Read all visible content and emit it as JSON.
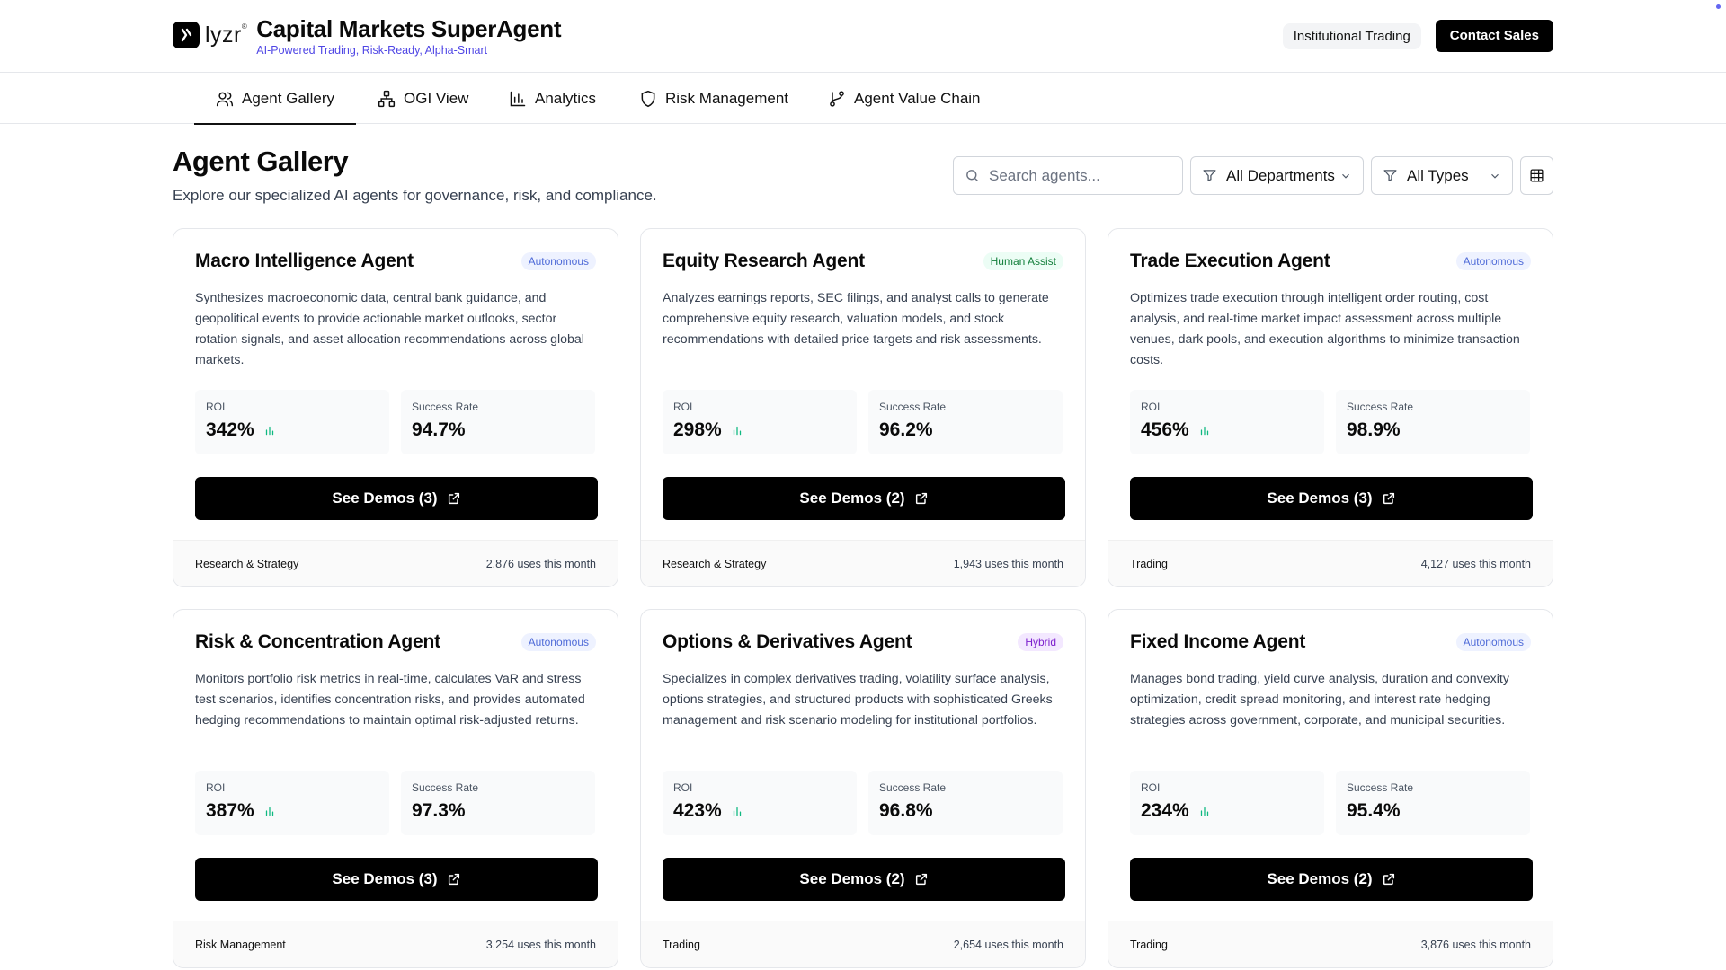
{
  "header": {
    "logo_text": "lyzr",
    "title": "Capital Markets SuperAgent",
    "subtitle": "AI-Powered Trading, Risk-Ready, Alpha-Smart",
    "pill_label": "Institutional Trading",
    "contact_label": "Contact Sales"
  },
  "tabs": [
    {
      "label": "Agent Gallery",
      "icon": "users-icon",
      "active": true
    },
    {
      "label": "OGI View",
      "icon": "network-icon",
      "active": false
    },
    {
      "label": "Analytics",
      "icon": "bar-chart-icon",
      "active": false
    },
    {
      "label": "Risk Management",
      "icon": "shield-icon",
      "active": false
    },
    {
      "label": "Agent Value Chain",
      "icon": "git-branch-icon",
      "active": false
    }
  ],
  "page": {
    "title": "Agent Gallery",
    "description": "Explore our specialized AI agents for governance, risk, and compliance."
  },
  "controls": {
    "search_placeholder": "Search agents...",
    "department_value": "All Departments",
    "type_value": "All Types"
  },
  "labels": {
    "roi": "ROI",
    "success_rate": "Success Rate"
  },
  "agents": [
    {
      "name": "Macro Intelligence Agent",
      "badge": "Autonomous",
      "description": "Synthesizes macroeconomic data, central bank guidance, and geopolitical events to provide actionable market outlooks, sector rotation signals, and asset allocation recommendations across global markets.",
      "roi": "342%",
      "success_rate": "94.7%",
      "demo_label": "See Demos (3)",
      "department": "Research & Strategy",
      "uses": "2,876 uses this month"
    },
    {
      "name": "Equity Research Agent",
      "badge": "Human Assist",
      "description": "Analyzes earnings reports, SEC filings, and analyst calls to generate comprehensive equity research, valuation models, and stock recommendations with detailed price targets and risk assessments.",
      "roi": "298%",
      "success_rate": "96.2%",
      "demo_label": "See Demos (2)",
      "department": "Research & Strategy",
      "uses": "1,943 uses this month"
    },
    {
      "name": "Trade Execution Agent",
      "badge": "Autonomous",
      "description": "Optimizes trade execution through intelligent order routing, cost analysis, and real-time market impact assessment across multiple venues, dark pools, and execution algorithms to minimize transaction costs.",
      "roi": "456%",
      "success_rate": "98.9%",
      "demo_label": "See Demos (3)",
      "department": "Trading",
      "uses": "4,127 uses this month"
    },
    {
      "name": "Risk & Concentration Agent",
      "badge": "Autonomous",
      "description": "Monitors portfolio risk metrics in real-time, calculates VaR and stress test scenarios, identifies concentration risks, and provides automated hedging recommendations to maintain optimal risk-adjusted returns.",
      "roi": "387%",
      "success_rate": "97.3%",
      "demo_label": "See Demos (3)",
      "department": "Risk Management",
      "uses": "3,254 uses this month"
    },
    {
      "name": "Options & Derivatives Agent",
      "badge": "Hybrid",
      "description": "Specializes in complex derivatives trading, volatility surface analysis, options strategies, and structured products with sophisticated Greeks management and risk scenario modeling for institutional portfolios.",
      "roi": "423%",
      "success_rate": "96.8%",
      "demo_label": "See Demos (2)",
      "department": "Trading",
      "uses": "2,654 uses this month"
    },
    {
      "name": "Fixed Income Agent",
      "badge": "Autonomous",
      "description": "Manages bond trading, yield curve analysis, duration and convexity optimization, credit spread monitoring, and interest rate hedging strategies across government, corporate, and municipal securities.",
      "roi": "234%",
      "success_rate": "95.4%",
      "demo_label": "See Demos (2)",
      "department": "Trading",
      "uses": "3,876 uses this month"
    }
  ]
}
